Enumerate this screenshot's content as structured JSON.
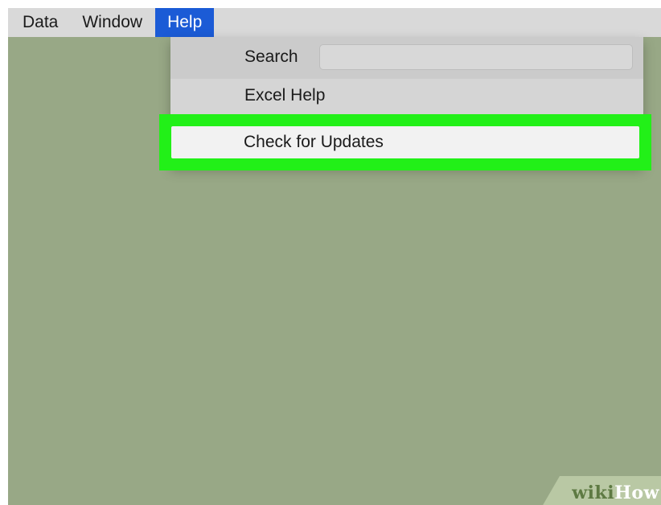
{
  "menubar": {
    "items": [
      {
        "label": "Data",
        "active": false
      },
      {
        "label": "Window",
        "active": false
      },
      {
        "label": "Help",
        "active": true
      }
    ]
  },
  "help_menu": {
    "search_label": "Search",
    "search_value": "",
    "items": [
      {
        "label": "Excel Help"
      },
      {
        "label": "Check for Updates",
        "highlighted": true
      }
    ]
  },
  "watermark": {
    "part1": "wiki",
    "part2": "How"
  },
  "colors": {
    "background": "#98a886",
    "menubar": "#d9d9d9",
    "active_menu": "#1b5bd6",
    "highlight_frame": "#22f018",
    "dropdown": "#d5d5d5"
  }
}
